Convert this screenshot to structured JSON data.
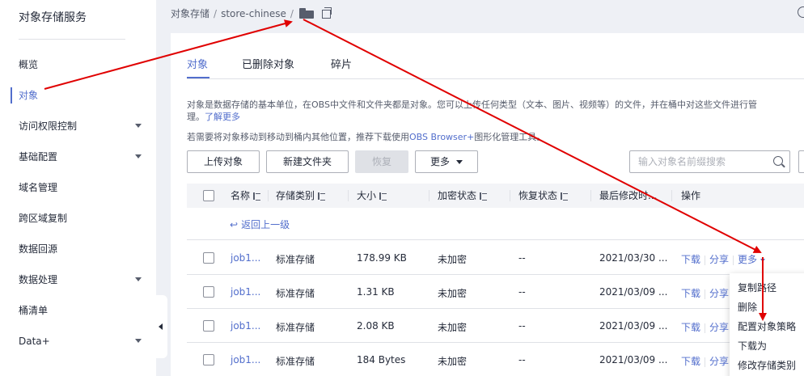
{
  "sidebar": {
    "title": "对象存储服务",
    "items": [
      {
        "label": "概览",
        "has_caret": false
      },
      {
        "label": "对象",
        "has_caret": false,
        "active": true
      },
      {
        "label": "访问权限控制",
        "has_caret": true
      },
      {
        "label": "基础配置",
        "has_caret": true
      },
      {
        "label": "域名管理",
        "has_caret": false
      },
      {
        "label": "跨区域复制",
        "has_caret": false
      },
      {
        "label": "数据回源",
        "has_caret": false
      },
      {
        "label": "数据处理",
        "has_caret": true
      },
      {
        "label": "桶清单",
        "has_caret": false
      },
      {
        "label": "Data+",
        "has_caret": true
      }
    ]
  },
  "breadcrumb": {
    "root": "对象存储",
    "bucket": "store-chinese",
    "sep": "/"
  },
  "tabs": [
    {
      "label": "对象",
      "active": true
    },
    {
      "label": "已删除对象",
      "active": false
    },
    {
      "label": "碎片",
      "active": false
    }
  ],
  "description": {
    "line1": "对象是数据存储的基本单位，在OBS中文件和文件夹都是对象。您可以上传任何类型（文本、图片、视频等）的文件，并在桶中对这些文件进行管",
    "line2_prefix": "理。",
    "line2_link": "了解更多",
    "line3_prefix": "若需要将对象移动到移动到桶内其他位置，推荐下载使用",
    "line3_link": "OBS Browser+",
    "line3_suffix": "图形化管理工具。"
  },
  "toolbar": {
    "upload": "上传对象",
    "new_folder": "新建文件夹",
    "restore": "恢复",
    "more": "更多",
    "search_placeholder": "输入对象名前缀搜索"
  },
  "table": {
    "headers": {
      "name": "名称",
      "storage_class": "存储类别",
      "size": "大小",
      "encryption": "加密状态",
      "restore_status": "恢复状态",
      "last_modified": "最后修改时...",
      "actions": "操作"
    },
    "back_label": "返回上一级",
    "rows": [
      {
        "name": "job1...",
        "storage_class": "标准存储",
        "size": "178.99 KB",
        "encryption": "未加密",
        "restore_status": "--",
        "last_modified": "2021/03/30 ..."
      },
      {
        "name": "job1...",
        "storage_class": "标准存储",
        "size": "1.31 KB",
        "encryption": "未加密",
        "restore_status": "--",
        "last_modified": "2021/03/09 ..."
      },
      {
        "name": "job1...",
        "storage_class": "标准存储",
        "size": "2.08 KB",
        "encryption": "未加密",
        "restore_status": "--",
        "last_modified": "2021/03/09 ..."
      },
      {
        "name": "job1...",
        "storage_class": "标准存储",
        "size": "184 Bytes",
        "encryption": "未加密",
        "restore_status": "--",
        "last_modified": "2021/03/09 ..."
      }
    ],
    "action_download": "下载",
    "action_share": "分享",
    "action_more": "更多"
  },
  "more_menu": {
    "items": [
      "复制路径",
      "删除",
      "配置对象策略",
      "下载为",
      "修改存储类别"
    ]
  },
  "colors": {
    "accent": "#526ecc",
    "annotation_arrow": "#e00000"
  }
}
